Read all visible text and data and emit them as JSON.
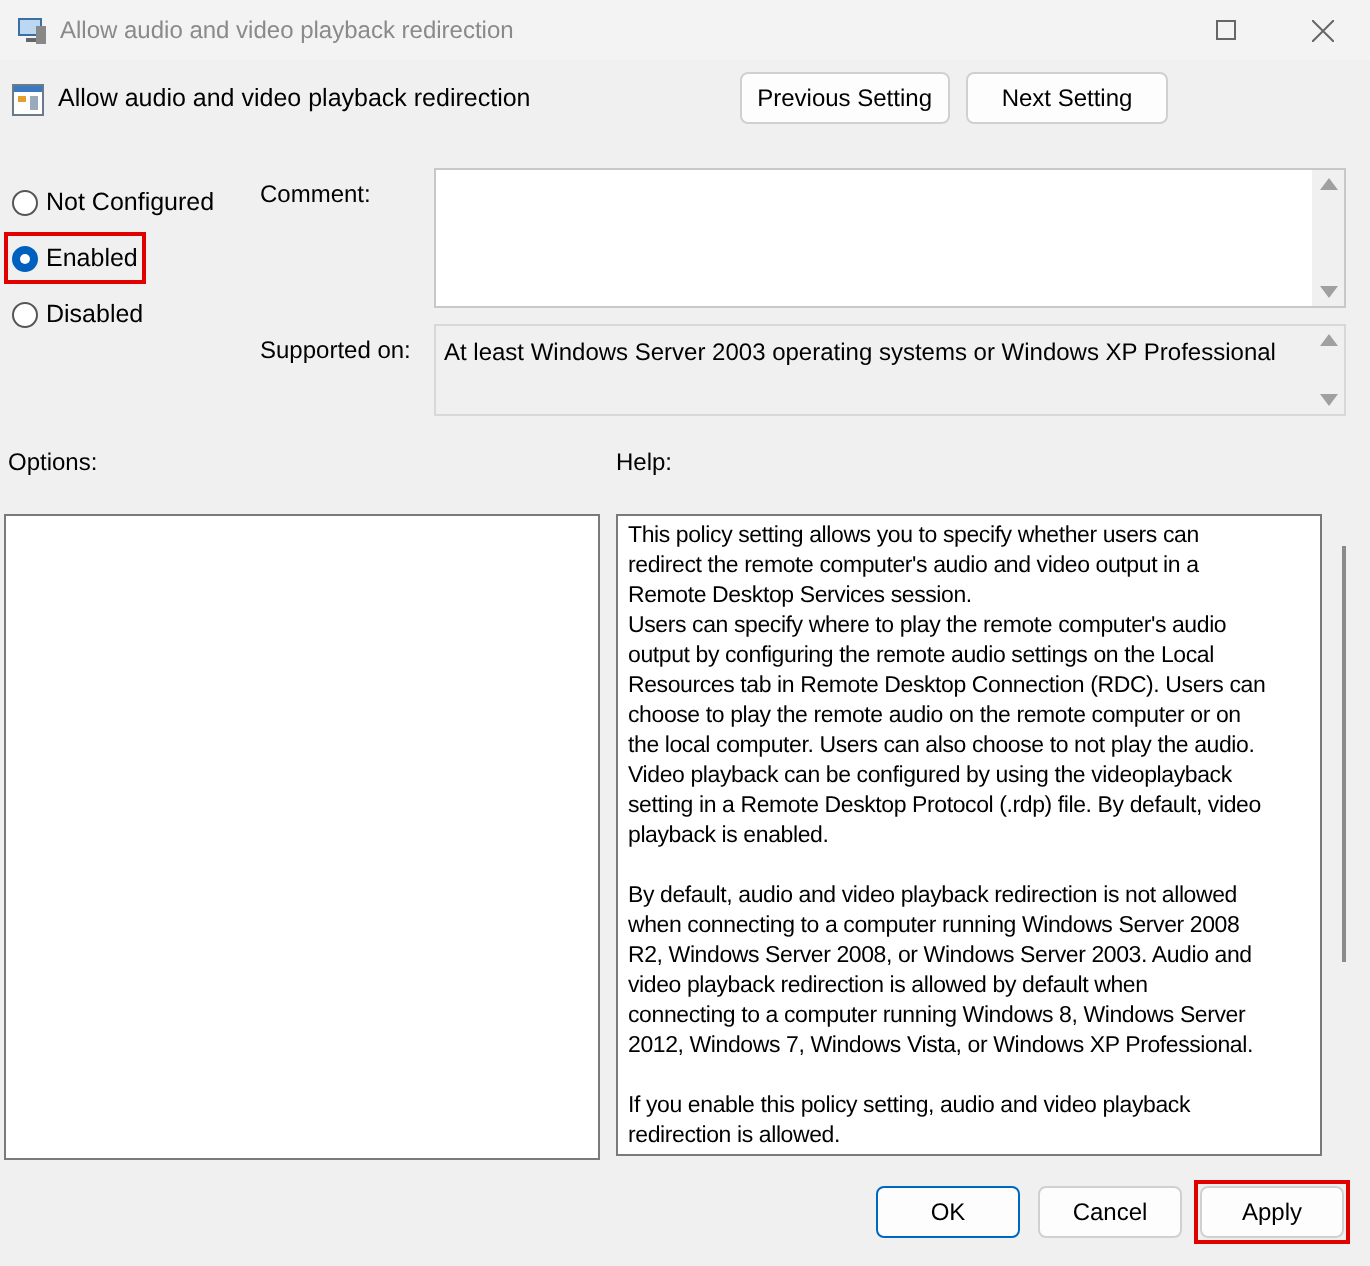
{
  "window": {
    "title": "Allow audio and video playback redirection"
  },
  "header": {
    "title": "Allow audio and video playback redirection",
    "buttons": [
      "Previous Setting",
      "Next Setting"
    ]
  },
  "states": [
    {
      "label": "Not Configured",
      "selected": false,
      "highlighted": false
    },
    {
      "label": "Enabled",
      "selected": true,
      "highlighted": true
    },
    {
      "label": "Disabled",
      "selected": false,
      "highlighted": false
    }
  ],
  "comment": {
    "label": "Comment:"
  },
  "supported_on": {
    "label": "Supported on:",
    "value": "At least Windows Server 2003 operating systems or Windows XP Professional"
  },
  "options": {
    "label": "Options:"
  },
  "help": {
    "label": "Help:",
    "paragraphs": [
      [
        "This policy setting allows you to specify whether users can",
        "redirect the remote computer's audio and video output in a",
        "Remote Desktop Services session."
      ],
      [
        "Users can specify where to play the remote computer's audio",
        "output by configuring the remote audio settings on the Local",
        "Resources tab in Remote Desktop Connection (RDC). Users can",
        "choose to play the remote audio on the remote computer or on",
        "the local computer. Users can also choose to not play the audio.",
        "Video playback can be configured by using the videoplayback",
        "setting in a Remote Desktop Protocol (.rdp) file. By default, video",
        "playback is enabled."
      ],
      [
        "By default, audio and video playback redirection is not allowed",
        "when connecting to a computer running Windows Server 2008",
        "R2, Windows Server 2008, or Windows Server 2003. Audio and",
        "video playback redirection is allowed by default when",
        "connecting to a computer running Windows 8, Windows Server",
        "2012, Windows 7, Windows Vista, or Windows XP Professional."
      ],
      [
        "If you enable this policy setting, audio and video playback",
        "redirection is allowed."
      ]
    ]
  },
  "buttons": [
    {
      "label": "OK",
      "kind": "default",
      "highlighted": false
    },
    {
      "label": "Cancel",
      "kind": "normal",
      "highlighted": false
    },
    {
      "label": "Apply",
      "kind": "normal",
      "highlighted": true
    }
  ]
}
